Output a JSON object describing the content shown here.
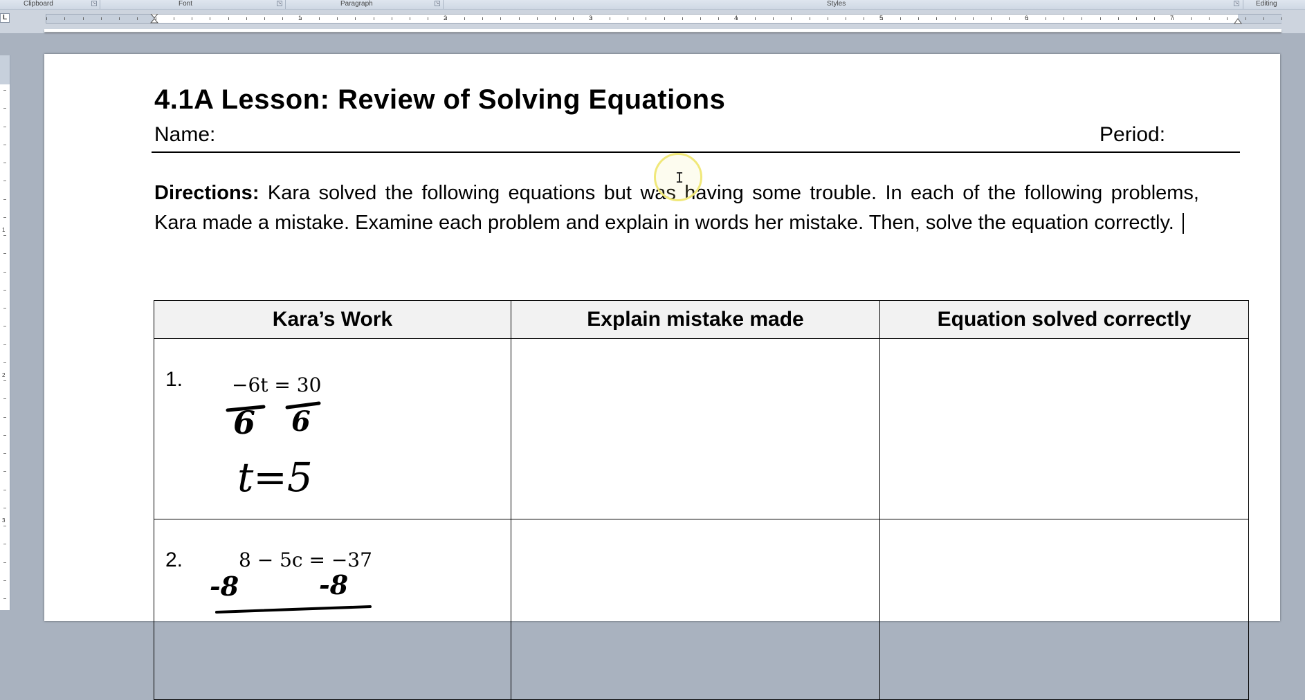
{
  "ribbon": {
    "groups": [
      "Clipboard",
      "Font",
      "Paragraph",
      "Styles",
      "Editing"
    ]
  },
  "ruler": {
    "tab_selector": "L",
    "numbers": [
      "1",
      "2",
      "3",
      "4",
      "5",
      "6",
      "7"
    ],
    "vertical_numbers": [
      "1",
      "2",
      "3"
    ]
  },
  "document": {
    "title": "4.1A Lesson: Review of Solving Equations",
    "name_label": "Name:",
    "period_label": "Period:",
    "directions_label": "Directions:",
    "directions_text": " Kara solved the following equations but was having some trouble. In each of the following problems, Kara made a mistake. Examine each problem and explain in words her mistake. Then, solve the equation correctly."
  },
  "table": {
    "headers": [
      "Kara’s Work",
      "Explain mistake made",
      "Equation solved correctly"
    ],
    "rows": [
      {
        "num": "1.",
        "equation": "−6t = 30",
        "handwritten": [
          "6",
          "6",
          "t=5"
        ]
      },
      {
        "num": "2.",
        "equation": "8 − 5c = −37",
        "handwritten": [
          "-8",
          "-8"
        ]
      }
    ]
  },
  "colors": {
    "app_background": "#a9b2bf",
    "header_fill": "#f2f2f2",
    "cursor_highlight": "#f0e87a"
  }
}
